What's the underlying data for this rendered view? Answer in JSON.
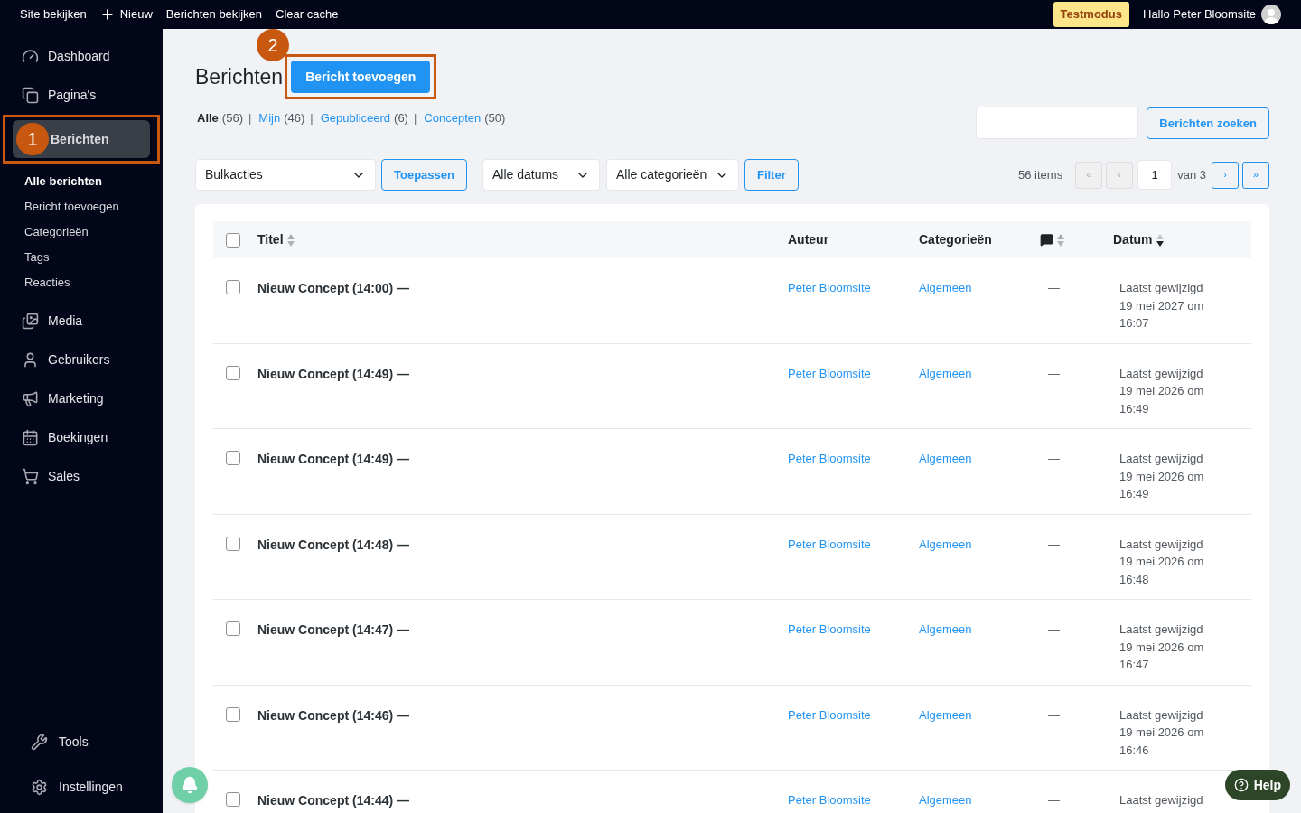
{
  "topbar": {
    "links": [
      {
        "label": "Site bekijken",
        "kind": "link"
      },
      {
        "label": "Nieuw",
        "kind": "new"
      },
      {
        "label": "Berichten bekijken",
        "kind": "link"
      },
      {
        "label": "Clear cache",
        "kind": "link"
      }
    ],
    "badge": "Testmodus",
    "greeting": "Hallo Peter Bloomsite"
  },
  "sidebar": {
    "items": [
      {
        "label": "Dashboard",
        "selected": false
      },
      {
        "label": "Pagina's",
        "selected": false
      },
      {
        "label": "Berichten",
        "selected": true,
        "annotation": "1",
        "children": [
          {
            "label": "Alle berichten",
            "selected": true
          },
          {
            "label": "Bericht toevoegen",
            "selected": false
          },
          {
            "label": "Categorieën",
            "selected": false
          },
          {
            "label": "Tags",
            "selected": false
          },
          {
            "label": "Reacties",
            "selected": false
          }
        ]
      },
      {
        "label": "Media",
        "selected": false
      },
      {
        "label": "Gebruikers",
        "selected": false
      },
      {
        "label": "Marketing",
        "selected": false
      },
      {
        "label": "Boekingen",
        "selected": false
      },
      {
        "label": "Sales",
        "selected": false
      }
    ],
    "footer_items": [
      {
        "label": "Tools",
        "selected": false
      },
      {
        "label": "Instellingen",
        "selected": false
      }
    ]
  },
  "page": {
    "title": "Berichten",
    "add_button": {
      "label": "Bericht toevoegen",
      "annotation": "2"
    },
    "views": [
      {
        "label": "Alle",
        "count": "(56)",
        "selected": true
      },
      {
        "separator": "|",
        "label": "Mijn",
        "count": "(46)",
        "selected": false
      },
      {
        "separator": "|",
        "label": "Gepubliceerd",
        "count": "(6)",
        "selected": false
      },
      {
        "separator": "|",
        "label": "Concepten",
        "count": "(50)",
        "selected": false
      }
    ],
    "search_button": "Berichten zoeken",
    "filters": {
      "bulk_select": "Bulkacties",
      "apply_button": "Toepassen",
      "date_select": "Alle datums",
      "category_select": "Alle categorieën",
      "filter_button": "Filter"
    },
    "pagination": {
      "count": "56 items",
      "buttons": [
        {
          "label": "«",
          "disabled": true
        },
        {
          "label": "‹",
          "disabled": true
        }
      ],
      "page": "1",
      "of": "van 3",
      "next_buttons": [
        {
          "label": "›",
          "disabled": false
        },
        {
          "label": "»",
          "disabled": false
        }
      ]
    }
  },
  "table": {
    "select_all_checked": false,
    "columns": [
      {
        "label": "Titel",
        "kind": "text",
        "sortable": true,
        "sorted_descending": false
      },
      {
        "label": "Auteur",
        "kind": "text"
      },
      {
        "label": "Categorieën",
        "kind": "text"
      },
      {
        "kind": "comments",
        "sortable": true,
        "sorted_descending": false
      },
      {
        "label": "Datum",
        "kind": "text",
        "sortable": true,
        "sorted_descending": true
      }
    ],
    "rows": [
      {
        "title": "Nieuw Concept (14:00) —",
        "author": "Peter Bloomsite",
        "category": "Algemeen",
        "comments": "—",
        "date_lines": [
          "Laatst gewijzigd",
          "19 mei 2027 om",
          "16:07"
        ],
        "checked": false
      },
      {
        "title": "Nieuw Concept (14:49) —",
        "author": "Peter Bloomsite",
        "category": "Algemeen",
        "comments": "—",
        "date_lines": [
          "Laatst gewijzigd",
          "19 mei 2026 om",
          "16:49"
        ],
        "checked": false
      },
      {
        "title": "Nieuw Concept (14:49) —",
        "author": "Peter Bloomsite",
        "category": "Algemeen",
        "comments": "—",
        "date_lines": [
          "Laatst gewijzigd",
          "19 mei 2026 om",
          "16:49"
        ],
        "checked": false
      },
      {
        "title": "Nieuw Concept (14:48) —",
        "author": "Peter Bloomsite",
        "category": "Algemeen",
        "comments": "—",
        "date_lines": [
          "Laatst gewijzigd",
          "19 mei 2026 om",
          "16:48"
        ],
        "checked": false
      },
      {
        "title": "Nieuw Concept (14:47) —",
        "author": "Peter Bloomsite",
        "category": "Algemeen",
        "comments": "—",
        "date_lines": [
          "Laatst gewijzigd",
          "19 mei 2026 om",
          "16:47"
        ],
        "checked": false
      },
      {
        "title": "Nieuw Concept (14:46) —",
        "author": "Peter Bloomsite",
        "category": "Algemeen",
        "comments": "—",
        "date_lines": [
          "Laatst gewijzigd",
          "19 mei 2026 om",
          "16:46"
        ],
        "checked": false
      },
      {
        "title": "Nieuw Concept (14:44) —",
        "author": "Peter Bloomsite",
        "category": "Algemeen",
        "comments": "—",
        "date_lines": [
          "Laatst gewijzigd"
        ],
        "checked": false
      }
    ]
  },
  "help_button": "Help"
}
